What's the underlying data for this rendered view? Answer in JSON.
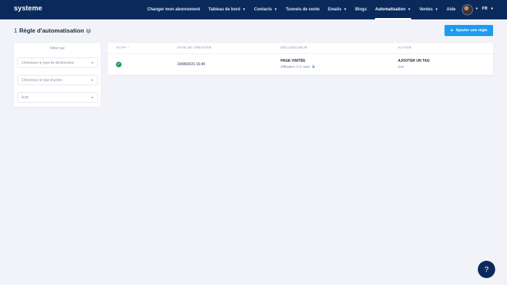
{
  "app": {
    "logo": "systeme"
  },
  "nav": {
    "items": [
      {
        "label": "Changer mon abonnement",
        "has_dropdown": false
      },
      {
        "label": "Tableau de bord",
        "has_dropdown": true
      },
      {
        "label": "Contacts",
        "has_dropdown": true
      },
      {
        "label": "Tunnels de vente",
        "has_dropdown": false
      },
      {
        "label": "Emails",
        "has_dropdown": true
      },
      {
        "label": "Blogs",
        "has_dropdown": false
      },
      {
        "label": "Automatisation",
        "has_dropdown": true,
        "active": true
      },
      {
        "label": "Ventes",
        "has_dropdown": true
      },
      {
        "label": "Aide",
        "has_dropdown": false
      }
    ],
    "language": "FR"
  },
  "page": {
    "count": "1",
    "title": "Règle d'automatisation",
    "add_button_label": "Ajouter une règle"
  },
  "filters": {
    "title": "Filtrer par",
    "trigger_type_placeholder": "Choisissez le type de déclencheur",
    "action_type_placeholder": "Choisissez le type d'action",
    "status_placeholder": "Actif"
  },
  "table": {
    "headers": {
      "active": "Actif ↑",
      "created_date": "Date de création",
      "trigger": "Déclencheur",
      "action": "Action"
    },
    "rows": [
      {
        "active": true,
        "created_date": "19/08/2021 16:45",
        "trigger_title": "PAGE VISITÉE",
        "trigger_detail": "Affiliation 2.0: web",
        "action_title": "AJOUTER UN TAG",
        "action_detail": "test"
      }
    ]
  },
  "colors": {
    "topbar": "#0b2a5c",
    "accent": "#1e9bf0",
    "success": "#1e9e55",
    "background": "#f1f3f8"
  },
  "icons": {
    "help": "question-circle-icon",
    "check": "check-circle-icon",
    "external": "external-link-icon",
    "help_fab": "question-mark-icon"
  }
}
